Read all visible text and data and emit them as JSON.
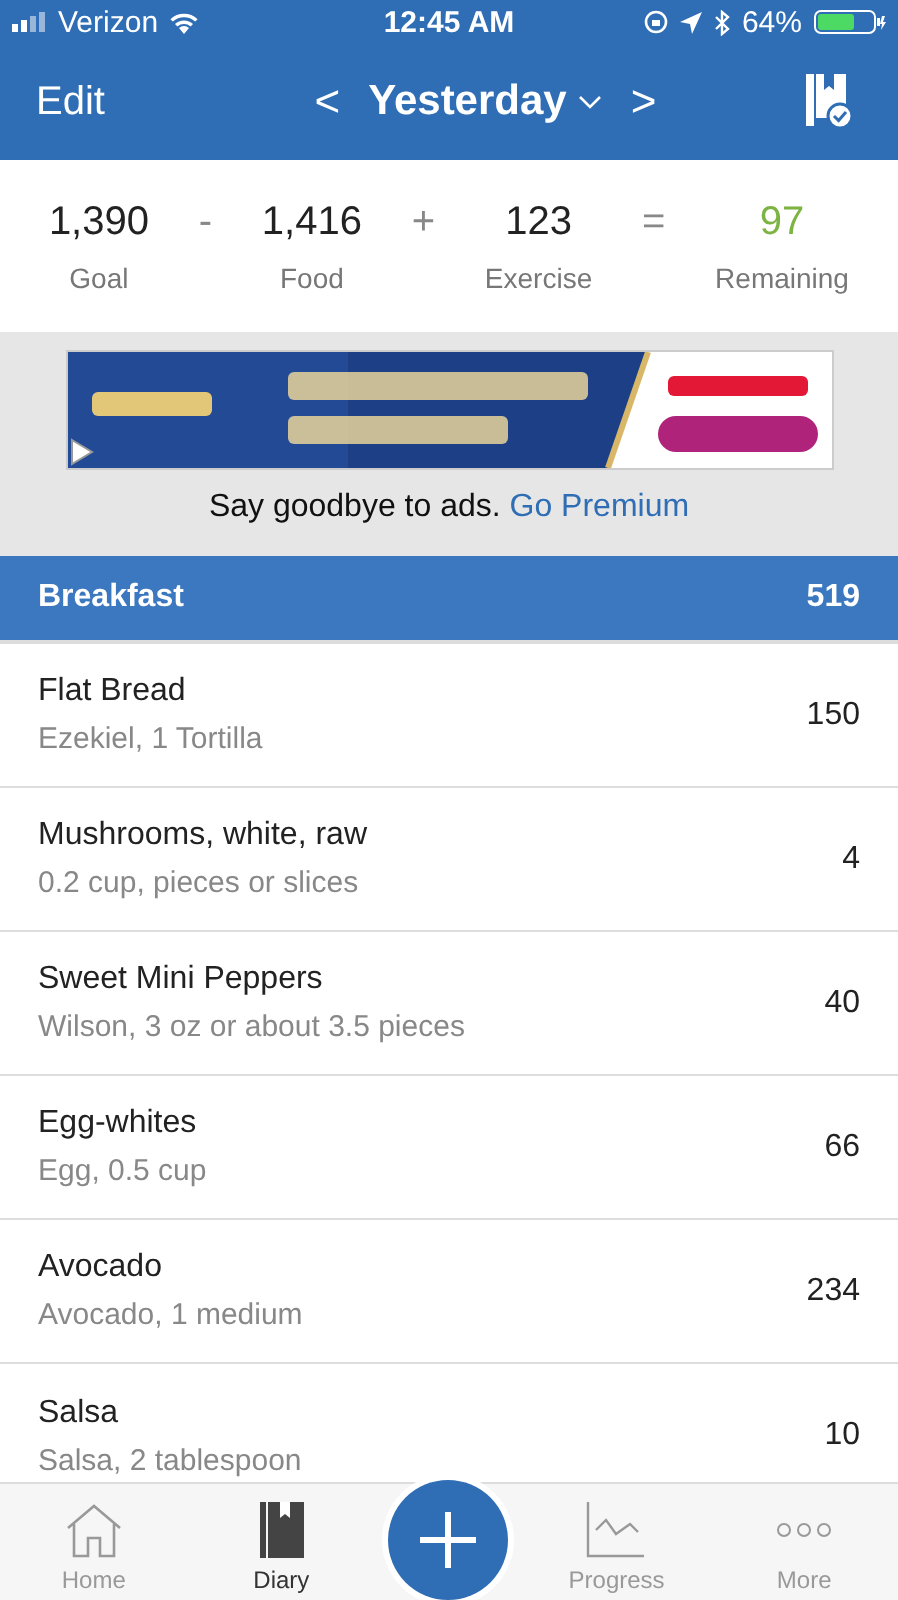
{
  "status_bar": {
    "carrier": "Verizon",
    "time": "12:45 AM",
    "battery": "64%"
  },
  "header": {
    "edit": "Edit",
    "prev": "<",
    "title": "Yesterday",
    "next": ">"
  },
  "summary": [
    {
      "value": "1,390",
      "label": "Goal",
      "kind": "plain"
    },
    {
      "op": "-"
    },
    {
      "value": "1,416",
      "label": "Food",
      "kind": "plain"
    },
    {
      "op": "+"
    },
    {
      "value": "123",
      "label": "Exercise",
      "kind": "plain"
    },
    {
      "op": "="
    },
    {
      "value": "97",
      "label": "Remaining",
      "kind": "result"
    }
  ],
  "ad": {
    "kind": "picture",
    "text": "Say goodbye to ads.",
    "link": "Go Premium"
  },
  "meal": {
    "name": "Breakfast",
    "calories": "519"
  },
  "foods": [
    {
      "name": "Flat Bread",
      "detail": "Ezekiel, 1 Tortilla",
      "calories": "150"
    },
    {
      "name": "Mushrooms, white, raw",
      "detail": "0.2 cup, pieces or slices",
      "calories": "4"
    },
    {
      "name": "Sweet Mini Peppers",
      "detail": "Wilson, 3 oz  or about 3.5 pieces",
      "calories": "40"
    },
    {
      "name": "Egg-whites",
      "detail": "Egg, 0.5 cup",
      "calories": "66"
    },
    {
      "name": "Avocado",
      "detail": "Avocado, 1 medium",
      "calories": "234"
    },
    {
      "name": "Salsa",
      "detail": "Salsa, 2 tablespoon",
      "calories": "10"
    }
  ],
  "tabs": [
    {
      "label": "Home",
      "kind": "home",
      "selected": false
    },
    {
      "label": "Diary",
      "kind": "diary",
      "selected": true
    },
    {
      "kind": "add"
    },
    {
      "label": "Progress",
      "kind": "progress",
      "selected": false
    },
    {
      "label": "More",
      "kind": "more",
      "selected": false
    }
  ]
}
